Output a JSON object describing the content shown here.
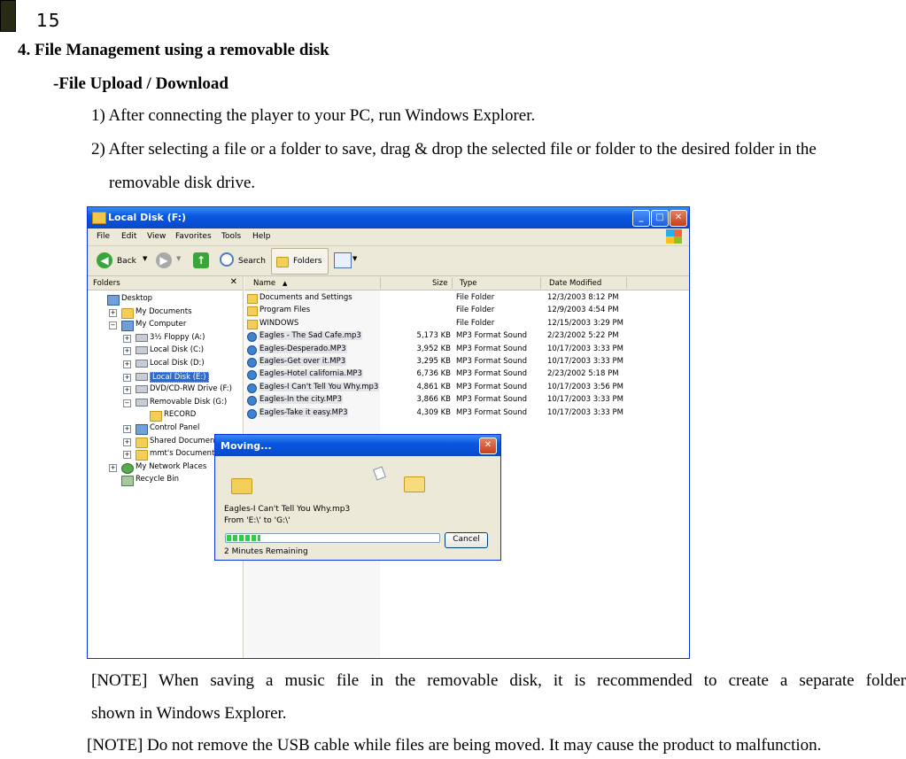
{
  "page": {
    "number": "15",
    "heading": "4. File Management using a removable disk",
    "subheading": "-File Upload / Download",
    "step1": "1) After connecting the player to your PC, run Windows Explorer.",
    "step2_line1": "2) After selecting a file or a folder to save, drag & drop the selected file or folder to the desired folder in the",
    "step2_line2": "removable disk drive.",
    "note1_line1": "[NOTE] When saving a music file in the removable disk, it is recommended to create a separate folder",
    "note1_line2": "shown in Windows Explorer.",
    "note2": "[NOTE] Do not remove the USB cable while files are being moved. It may cause the product to malfunction."
  },
  "explorer": {
    "title": "Local Disk (F:)",
    "menu": [
      "File",
      "Edit",
      "View",
      "Favorites",
      "Tools",
      "Help"
    ],
    "toolbar": {
      "back": "Back",
      "search": "Search",
      "folders": "Folders"
    },
    "folders_pane": {
      "header": "Folders",
      "close_glyph": "✕",
      "tree": [
        {
          "label": "Desktop",
          "icon": "desktop-icon",
          "expander": ""
        },
        {
          "label": "My Documents",
          "icon": "folder-icon",
          "expander": "+"
        },
        {
          "label": "My Computer",
          "icon": "computer-icon",
          "expander": "−"
        },
        {
          "label": "3½ Floppy (A:)",
          "icon": "floppy-icon",
          "expander": "+"
        },
        {
          "label": "Local Disk (C:)",
          "icon": "drive-icon",
          "expander": "+"
        },
        {
          "label": "Local Disk (D:)",
          "icon": "drive-icon",
          "expander": "+"
        },
        {
          "label": "Local Disk (E:)",
          "icon": "drive-icon",
          "expander": "+"
        },
        {
          "label": "DVD/CD-RW Drive (F:)",
          "icon": "cd-drive-icon",
          "expander": "+"
        },
        {
          "label": "Removable Disk (G:)",
          "icon": "removable-disk-icon",
          "expander": "−"
        },
        {
          "label": "RECORD",
          "icon": "folder-icon",
          "expander": ""
        },
        {
          "label": "Control Panel",
          "icon": "control-panel-icon",
          "expander": "+"
        },
        {
          "label": "Shared Documents",
          "icon": "folder-icon",
          "expander": "+"
        },
        {
          "label": "mmt's Documents",
          "icon": "folder-icon",
          "expander": "+"
        },
        {
          "label": "My Network Places",
          "icon": "network-icon",
          "expander": "+"
        },
        {
          "label": "Recycle Bin",
          "icon": "recycle-bin-icon",
          "expander": ""
        }
      ]
    },
    "columns": [
      "Name",
      "Size",
      "Type",
      "Date Modified"
    ],
    "files": [
      {
        "name": "Documents and Settings",
        "size": "",
        "type": "File Folder",
        "date": "12/3/2003 8:12 PM",
        "kind": "folder"
      },
      {
        "name": "Program Files",
        "size": "",
        "type": "File Folder",
        "date": "12/9/2003 4:54 PM",
        "kind": "folder"
      },
      {
        "name": "WINDOWS",
        "size": "",
        "type": "File Folder",
        "date": "12/15/2003 3:29 PM",
        "kind": "folder"
      },
      {
        "name": "Eagles - The Sad Cafe.mp3",
        "size": "5,173 KB",
        "type": "MP3 Format Sound",
        "date": "2/23/2002 5:22 PM",
        "kind": "mp3"
      },
      {
        "name": "Eagles-Desperado.MP3",
        "size": "3,952 KB",
        "type": "MP3 Format Sound",
        "date": "10/17/2003 3:33 PM",
        "kind": "mp3"
      },
      {
        "name": "Eagles-Get over it.MP3",
        "size": "3,295 KB",
        "type": "MP3 Format Sound",
        "date": "10/17/2003 3:33 PM",
        "kind": "mp3"
      },
      {
        "name": "Eagles-Hotel california.MP3",
        "size": "6,736 KB",
        "type": "MP3 Format Sound",
        "date": "2/23/2002 5:18 PM",
        "kind": "mp3"
      },
      {
        "name": "Eagles-I Can't Tell You Why.mp3",
        "size": "4,861 KB",
        "type": "MP3 Format Sound",
        "date": "10/17/2003 3:56 PM",
        "kind": "mp3"
      },
      {
        "name": "Eagles-In the city.MP3",
        "size": "3,866 KB",
        "type": "MP3 Format Sound",
        "date": "10/17/2003 3:33 PM",
        "kind": "mp3"
      },
      {
        "name": "Eagles-Take it easy.MP3",
        "size": "4,309 KB",
        "type": "MP3 Format Sound",
        "date": "10/17/2003 3:33 PM",
        "kind": "mp3"
      }
    ]
  },
  "moving_dialog": {
    "title": "Moving...",
    "filename": "Eagles-I Can't Tell You Why.mp3",
    "from_to": "From 'E:\\' to 'G:\\'",
    "progress_fraction": 0.16,
    "remaining": "2 Minutes Remaining",
    "cancel": "Cancel"
  }
}
